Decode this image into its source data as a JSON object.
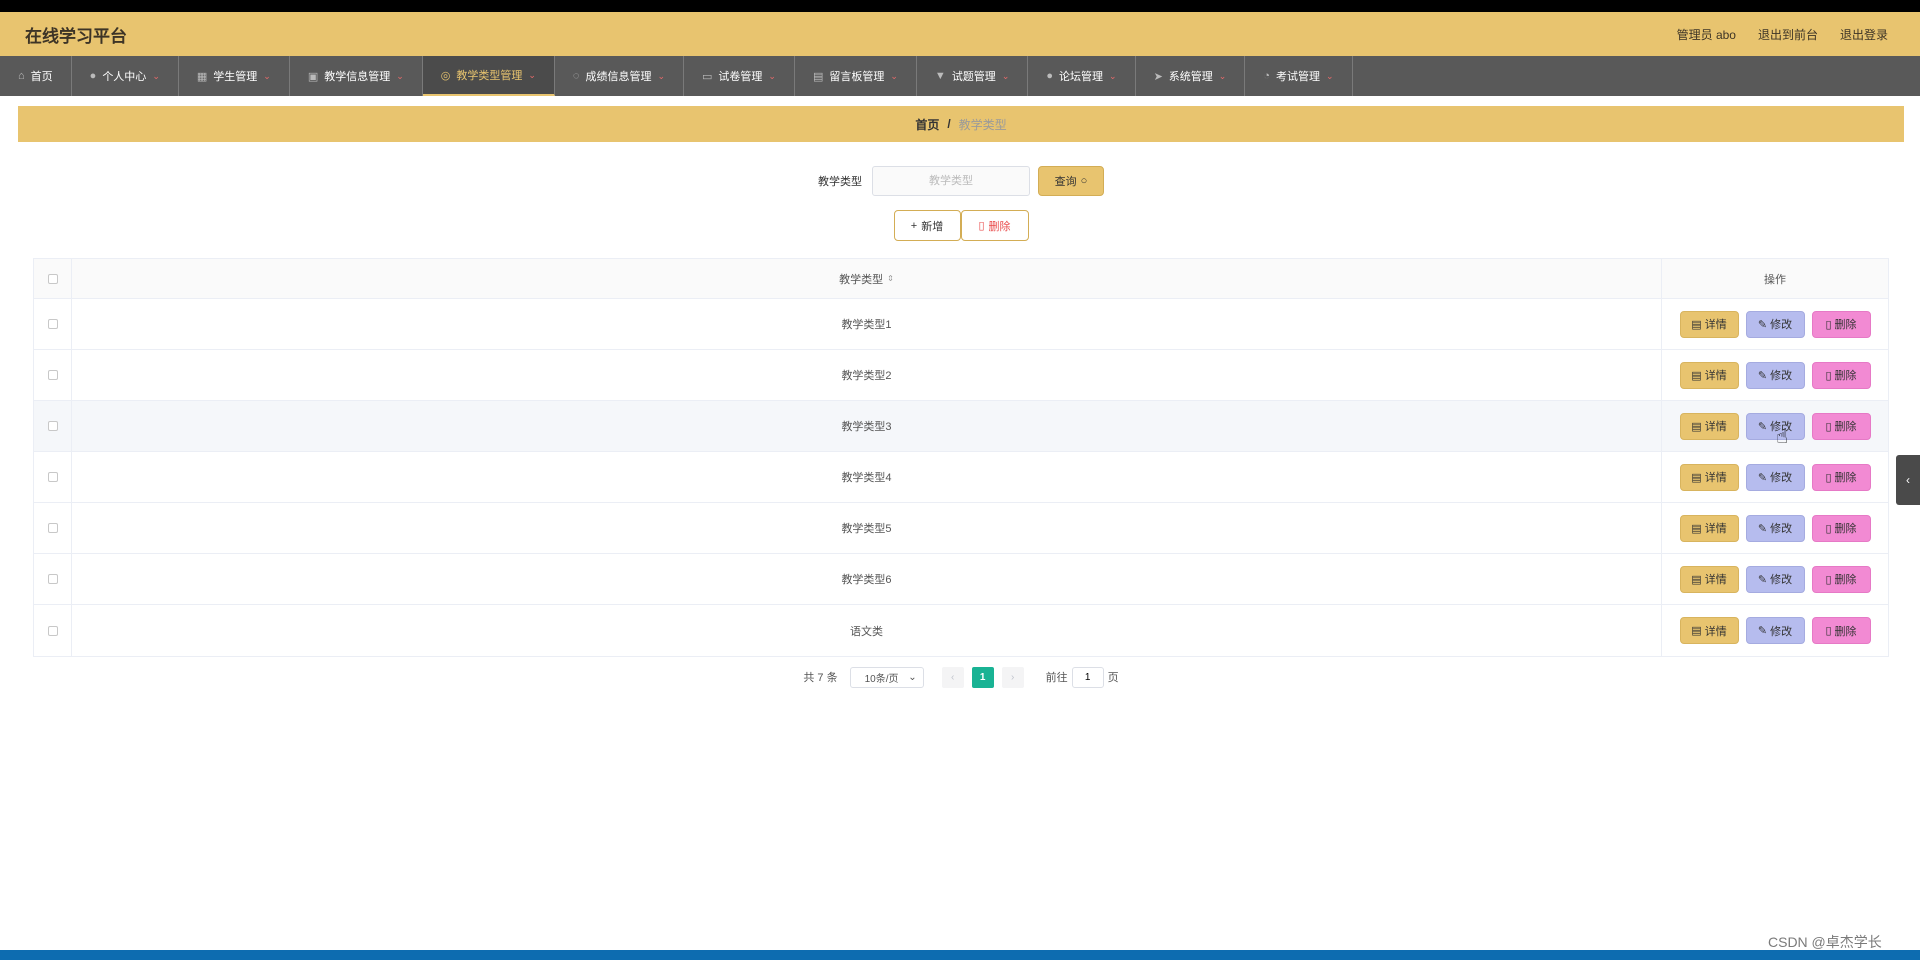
{
  "app": {
    "title": "在线学习平台"
  },
  "header": {
    "admin": "管理员 abo",
    "front": "退出到前台",
    "logout": "退出登录"
  },
  "nav": [
    {
      "label": "首页",
      "icon": "home-icon",
      "glyph": "⌂",
      "dropdown": false,
      "active": false
    },
    {
      "label": "个人中心",
      "icon": "user-icon",
      "glyph": "●",
      "dropdown": true,
      "active": false
    },
    {
      "label": "学生管理",
      "icon": "grid-icon",
      "glyph": "▦",
      "dropdown": true,
      "active": false
    },
    {
      "label": "教学信息管理",
      "icon": "clipboard-icon",
      "glyph": "▣",
      "dropdown": true,
      "active": false
    },
    {
      "label": "教学类型管理",
      "icon": "globe-icon",
      "glyph": "◎",
      "dropdown": true,
      "active": true
    },
    {
      "label": "成绩信息管理",
      "icon": "power-icon",
      "glyph": "◌",
      "dropdown": true,
      "active": false
    },
    {
      "label": "试卷管理",
      "icon": "monitor-icon",
      "glyph": "▭",
      "dropdown": true,
      "active": false
    },
    {
      "label": "留言板管理",
      "icon": "notebook-icon",
      "glyph": "▤",
      "dropdown": true,
      "active": false
    },
    {
      "label": "试题管理",
      "icon": "flag-icon",
      "glyph": "▼",
      "dropdown": true,
      "active": false
    },
    {
      "label": "论坛管理",
      "icon": "person-icon",
      "glyph": "●",
      "dropdown": true,
      "active": false
    },
    {
      "label": "系统管理",
      "icon": "send-icon",
      "glyph": "➤",
      "dropdown": true,
      "active": false
    },
    {
      "label": "考试管理",
      "icon": "bell-icon",
      "glyph": "◔",
      "dropdown": true,
      "active": false
    }
  ],
  "breadcrumb": {
    "home": "首页",
    "sep": "/",
    "current": "教学类型"
  },
  "search": {
    "label": "教学类型",
    "placeholder": "教学类型",
    "button": "查询"
  },
  "actions": {
    "add": "新增",
    "delete": "删除"
  },
  "table": {
    "columns": {
      "type": "教学类型",
      "ops": "操作"
    },
    "rows": [
      {
        "type": "教学类型1"
      },
      {
        "type": "教学类型2"
      },
      {
        "type": "教学类型3"
      },
      {
        "type": "教学类型4"
      },
      {
        "type": "教学类型5"
      },
      {
        "type": "教学类型6"
      },
      {
        "type": "语文类"
      }
    ],
    "row_buttons": {
      "detail": "详情",
      "edit": "修改",
      "delete": "删除"
    },
    "hover_row": 2
  },
  "pager": {
    "total": "共 7 条",
    "page_size": "10条/页",
    "current": "1",
    "goto": "前往",
    "goto_value": "1",
    "page_unit": "页"
  },
  "watermark": "CSDN @卓杰学长",
  "colors": {
    "gold": "#e8c46f",
    "nav": "#595959",
    "edit": "#b6bcee",
    "delete": "#f28ad3",
    "pager_active": "#19b394"
  }
}
